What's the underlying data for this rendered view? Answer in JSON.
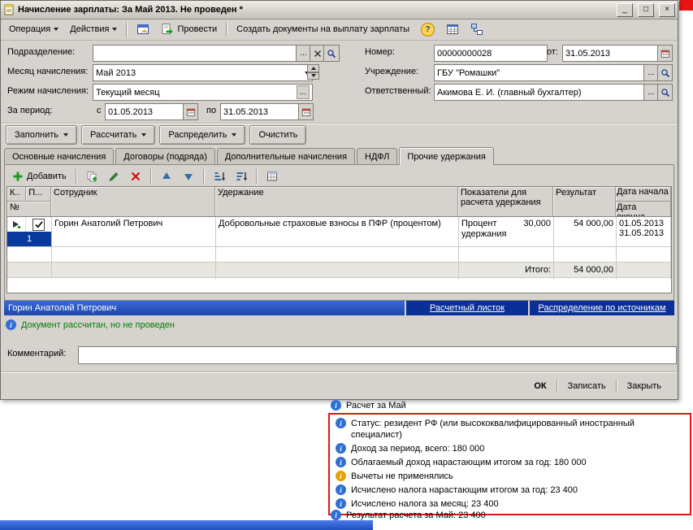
{
  "window": {
    "title": "Начисление зарплаты: За Май 2013. Не проведен *",
    "minimize": "_",
    "maximize": "□",
    "close": "×"
  },
  "icons": {
    "ellipsis": "...",
    "help": "?",
    "info": "i"
  },
  "toolbar": {
    "operation": "Операция",
    "actions": "Действия",
    "post": "Провести",
    "create_payment_docs": "Создать документы на выплату зарплаты"
  },
  "form": {
    "department": {
      "label": "Подразделение:",
      "value": ""
    },
    "accrual_month": {
      "label": "Месяц начисления:",
      "value": "Май 2013"
    },
    "accrual_mode": {
      "label": "Режим начисления:",
      "value": "Текущий месяц"
    },
    "period": {
      "label": "За период:",
      "from_label": "с",
      "from": "01.05.2013",
      "to_label": "по",
      "to": "31.05.2013"
    },
    "number": {
      "label": "Номер:",
      "value": "00000000028"
    },
    "date": {
      "label": "от:",
      "value": "31.05.2013"
    },
    "institution": {
      "label": "Учреждение:",
      "value": "ГБУ \"Ромашки\""
    },
    "responsible": {
      "label": "Ответственный:",
      "value": "Акимова Е. И. (главный бухгалтер)"
    }
  },
  "commands": {
    "fill": "Заполнить",
    "calculate": "Рассчитать",
    "distribute": "Распределить",
    "clear": "Очистить"
  },
  "tabs": [
    {
      "label": "Основные начисления"
    },
    {
      "label": "Договоры (подряда)"
    },
    {
      "label": "Дополнительные начисления"
    },
    {
      "label": "НДФЛ"
    },
    {
      "label": "Прочие удержания"
    }
  ],
  "grid": {
    "add": "Добавить",
    "headers": {
      "k": "К..",
      "p": "П...",
      "num": "№",
      "employee": "Сотрудник",
      "deduction": "Удержание",
      "indicators": "Показатели для расчета удержания",
      "result": "Результат",
      "date_start": "Дата начала",
      "date_end": "Дата оконча..."
    },
    "rows": [
      {
        "num": "1",
        "employee": "Горин Анатолий Петрович",
        "deduction": "Добровольные страховые взносы в ПФР (процентом)",
        "indicator_name": "Процент удержания",
        "indicator_value": "30,000",
        "result": "54 000,00",
        "date_start": "01.05.2013",
        "date_end": "31.05.2013"
      }
    ],
    "total_label": "Итого:",
    "total_value": "54 000,00"
  },
  "selection": {
    "employee": "Горин Анатолий Петрович",
    "links": [
      {
        "label": "Расчетный листок"
      },
      {
        "label": "Распределение по источникам"
      }
    ]
  },
  "status": {
    "text": "Документ рассчитан, но не проведен"
  },
  "comment": {
    "label": "Комментарий:",
    "value": ""
  },
  "footer": {
    "ok": "ОК",
    "save": "Записать",
    "close": "Закрыть"
  },
  "messages": {
    "calc_header": "Расчет за Май",
    "details": [
      "Статус: резидент РФ (или высококвалифицированный иностранный специалист)",
      "Доход за период, всего: 180 000",
      "Облагаемый доход нарастающим итогом за год: 180 000",
      "Вычеты не применялись",
      "Исчислено налога нарастающим итогом за год: 23 400",
      "Исчислено налога за месяц: 23 400"
    ],
    "result": "Результат расчета за Май: 23 400"
  }
}
